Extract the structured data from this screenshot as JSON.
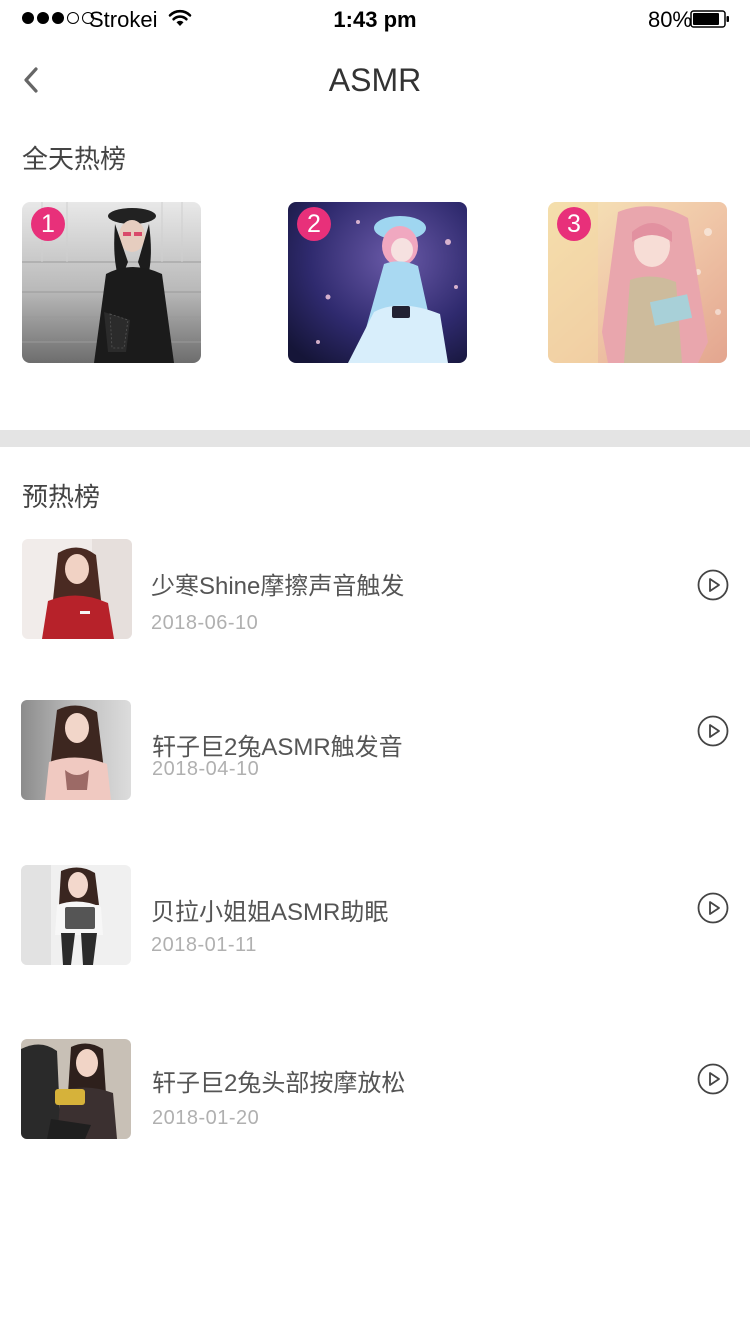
{
  "status_bar": {
    "carrier": "Strokei",
    "time": "1:43 pm",
    "battery": "80%",
    "signal_bars_filled": 3,
    "signal_bars_total": 5
  },
  "nav": {
    "title": "ASMR",
    "back_icon": "chevron-left-icon"
  },
  "daily_hot": {
    "title": "全天热榜",
    "items": [
      {
        "rank": "1"
      },
      {
        "rank": "2"
      },
      {
        "rank": "3"
      }
    ]
  },
  "pre_hot": {
    "title": "预热榜",
    "items": [
      {
        "title": "少寒Shine摩擦声音触发",
        "date": "2018-06-10"
      },
      {
        "title": "轩子巨2兔ASMR触发音",
        "date": "2018-04-10"
      },
      {
        "title": "贝拉小姐姐ASMR助眠",
        "date": "2018-01-11"
      },
      {
        "title": "轩子巨2兔头部按摩放松",
        "date": "2018-01-20"
      }
    ]
  },
  "colors": {
    "accent": "#e8307a",
    "divider": "#e4e4e4",
    "date_text": "#b0b0b0"
  }
}
